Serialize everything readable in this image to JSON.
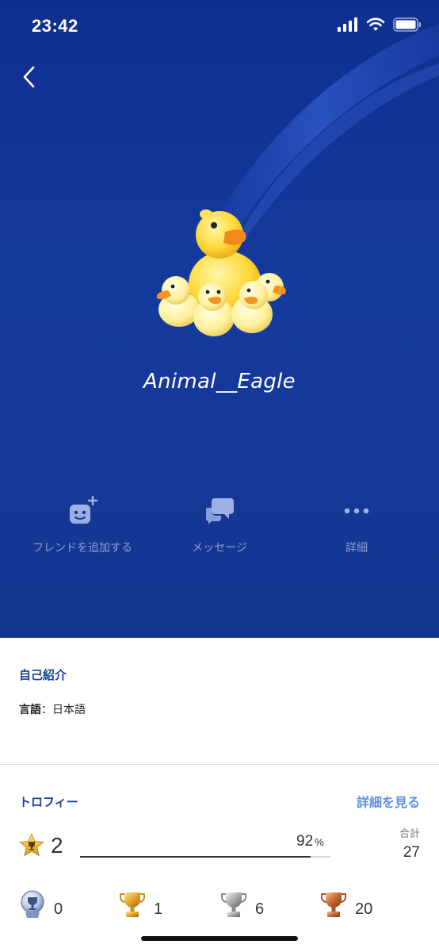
{
  "status_bar": {
    "time": "23:42"
  },
  "profile": {
    "username": "Animal__Eagle"
  },
  "actions": [
    {
      "label": "フレンドを追加する",
      "icon": "add-friend-icon"
    },
    {
      "label": "メッセージ",
      "icon": "message-icon"
    },
    {
      "label": "詳細",
      "icon": "more-icon"
    }
  ],
  "about": {
    "title": "自己紹介",
    "language_key": "言語",
    "language_sep": "：",
    "language_value": "日本語"
  },
  "trophies": {
    "title": "トロフィー",
    "see_more": "詳細を見る",
    "level": "2",
    "progress_percent": 92,
    "progress_text": "92",
    "progress_unit": "%",
    "total_label": "合計",
    "total": "27",
    "platinum": "0",
    "gold": "1",
    "silver": "6",
    "bronze": "20"
  },
  "colors": {
    "hero_background": "#13368f",
    "accent": "#1a3f9f",
    "link": "#5b8fe3"
  }
}
